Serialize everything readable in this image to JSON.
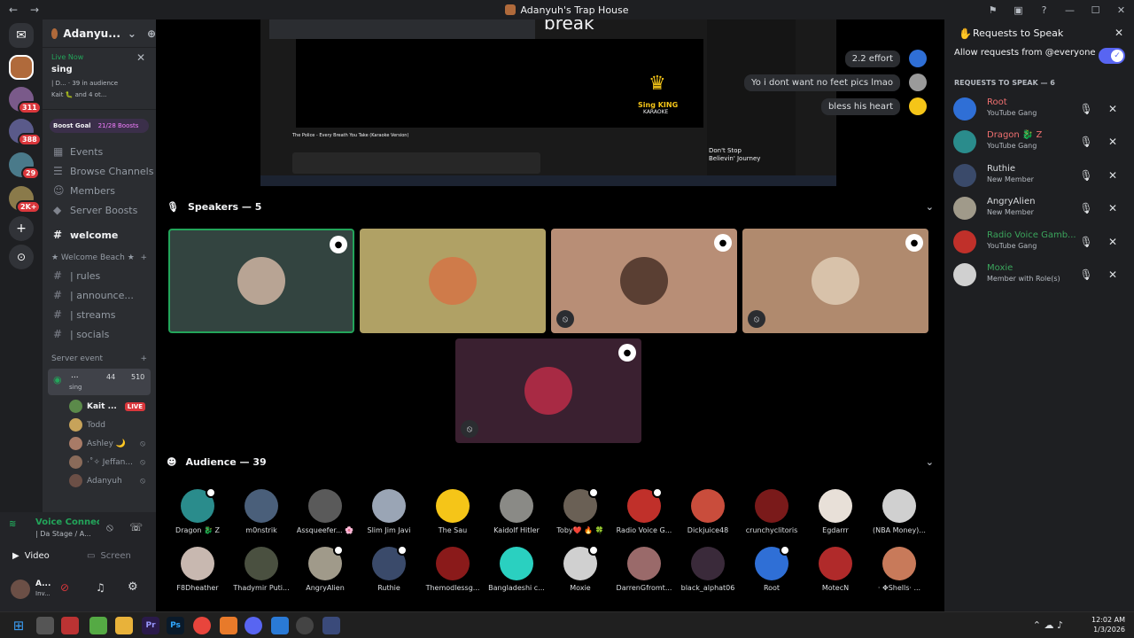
{
  "window": {
    "title": "Adanyuh's Trap House",
    "back": "←",
    "forward": "→"
  },
  "titlebar_icons": [
    "inbox-icon",
    "pip-icon",
    "help-icon",
    "minimize-icon",
    "maximize-icon",
    "close-icon"
  ],
  "rail": {
    "badges": [
      "311",
      "388",
      "29",
      "2K+"
    ]
  },
  "sidebar": {
    "server_name": "Adanyu...",
    "live_now": "Live Now",
    "live_title": "sing",
    "live_sub": "| D... · 39 in audience",
    "live_users": "Kait 🐛 and 4 ot...",
    "boost_goal": "Boost Goal",
    "boost_count": "21/28 Boosts",
    "menu": [
      "Events",
      "Browse Channels",
      "Members",
      "Server Boosts"
    ],
    "welcome": "welcome",
    "category1": "★ Welcome Beach ★",
    "channels": [
      "| rules",
      "| announce...",
      "| streams",
      "| socials"
    ],
    "category2": "Server event",
    "stage_name": "...",
    "stage_sub": "sing",
    "stage_count1": "44",
    "stage_count2": "510",
    "voice_users": [
      {
        "name": "Kait ...",
        "live": "LIVE",
        "color": "#5b8a4a"
      },
      {
        "name": "Todd",
        "live": "",
        "color": "#c7a35a"
      },
      {
        "name": "Ashley 🌙",
        "live": "",
        "color": "#a87b67"
      },
      {
        "name": "·˚✧ Jeffan...",
        "live": "",
        "color": "#8a6b5a"
      },
      {
        "name": "Adanyuh",
        "live": "",
        "color": "#6b4f46"
      }
    ]
  },
  "voice_panel": {
    "status": "Voice Connected",
    "channel": "| Da Stage / A...",
    "video": "Video",
    "screen": "Screen",
    "user_name": "A...",
    "user_status": "Inv..."
  },
  "main": {
    "chat": [
      {
        "text": "2.2 effort",
        "av": "#2f6fd6"
      },
      {
        "text": "Yo i dont want no feet pics lmao",
        "av": "#9a9a9a"
      },
      {
        "text": "bless his heart",
        "av": "#f5c518"
      }
    ],
    "stream_text": {
      "video_title": "The Police - Every Breath You Take (Karaoke Version)",
      "logo_top": "Sing KING",
      "logo_bottom": "KARAOKE",
      "side_title": "Don't Stop Believin' Journey",
      "partial": "break"
    },
    "speakers_label": "Speakers — 5",
    "speakers": [
      {
        "bg": "#334440",
        "pic": "#b8a494",
        "cam": true,
        "mute": false,
        "active": true
      },
      {
        "bg": "#b0a165",
        "pic": "#cf7b4a",
        "cam": false,
        "mute": false,
        "active": false
      },
      {
        "bg": "#b88e76",
        "pic": "#5a3f33",
        "cam": true,
        "mute": true,
        "active": false
      },
      {
        "bg": "#b08a6e",
        "pic": "#d8c2aa",
        "cam": true,
        "mute": true,
        "active": false
      },
      {
        "bg": "#3a2030",
        "pic": "#a82a44",
        "cam": true,
        "mute": true,
        "active": false
      }
    ],
    "audience_label": "Audience — 39",
    "audience": [
      {
        "name": "Dragon 🐉 Z",
        "color": "#2a8c8c",
        "badge": true
      },
      {
        "name": "m0nstrik",
        "color": "#4a5f7a",
        "badge": false
      },
      {
        "name": "Assqueefer... 🌸",
        "color": "#5a5a5a",
        "badge": false
      },
      {
        "name": "Slim Jim Javi",
        "color": "#9aa5b5",
        "badge": false
      },
      {
        "name": "The Sau",
        "color": "#f5c518",
        "badge": false
      },
      {
        "name": "Kaidolf Hitler",
        "color": "#8a8a86",
        "badge": false
      },
      {
        "name": "Toby❤️ 🔥 🍀",
        "color": "#6a6055",
        "badge": true
      },
      {
        "name": "Radio Voice G...",
        "color": "#c0302a",
        "badge": true
      },
      {
        "name": "Dickjuice48",
        "color": "#c94d3c",
        "badge": false
      },
      {
        "name": "crunchyclitoris",
        "color": "#7a1a1a",
        "badge": false
      },
      {
        "name": "Egdarrr",
        "color": "#e8e0d8",
        "badge": false
      },
      {
        "name": "(NBA Money)...",
        "color": "#d0d0d0",
        "badge": false
      },
      {
        "name": "F8Dheather",
        "color": "#c8b8b0",
        "badge": false
      },
      {
        "name": "Thadymir Puti...",
        "color": "#4a5040",
        "badge": false
      },
      {
        "name": "AngryAlien",
        "color": "#a09a8a",
        "badge": true
      },
      {
        "name": "Ruthie",
        "color": "#3a4a6a",
        "badge": true
      },
      {
        "name": "Themodlessg...",
        "color": "#8a1a1a",
        "badge": false
      },
      {
        "name": "Bangladeshi c...",
        "color": "#2ad0c0",
        "badge": false
      },
      {
        "name": "Moxie",
        "color": "#d0d0d0",
        "badge": true
      },
      {
        "name": "DarrenGfromt...",
        "color": "#9a6a6a",
        "badge": false
      },
      {
        "name": "black_alphat06",
        "color": "#3a2a3a",
        "badge": false
      },
      {
        "name": "Root",
        "color": "#2f6fd6",
        "badge": true
      },
      {
        "name": "MotecN",
        "color": "#b02a2a",
        "badge": false
      },
      {
        "name": "· ✥Shells· ...",
        "color": "#c87a5a",
        "badge": false
      }
    ]
  },
  "requests": {
    "title": "Requests to Speak",
    "allow_label": "Allow requests from @everyone",
    "section": "REQUESTS TO SPEAK — 6",
    "items": [
      {
        "name": "Root",
        "role": "YouTube Gang",
        "color": "#f07070",
        "av": "#2f6fd6"
      },
      {
        "name": "Dragon 🐉 Z",
        "role": "YouTube Gang",
        "color": "#f07070",
        "av": "#2a8c8c"
      },
      {
        "name": "Ruthie",
        "role": "New Member",
        "color": "#dbdee1",
        "av": "#3a4a6a"
      },
      {
        "name": "AngryAlien",
        "role": "New Member",
        "color": "#dbdee1",
        "av": "#a09a8a"
      },
      {
        "name": "Radio Voice Gamb...",
        "role": "YouTube Gang",
        "color": "#3ba55c",
        "av": "#c0302a"
      },
      {
        "name": "Moxie",
        "role": "Member with Role(s)",
        "color": "#3ba55c",
        "av": "#d0d0d0"
      }
    ]
  },
  "taskbar": {
    "time": "12:02 AM",
    "date": "1/3/2026"
  },
  "colors": {
    "accent": "#5865f2",
    "green": "#23a55a",
    "red": "#da373c"
  }
}
